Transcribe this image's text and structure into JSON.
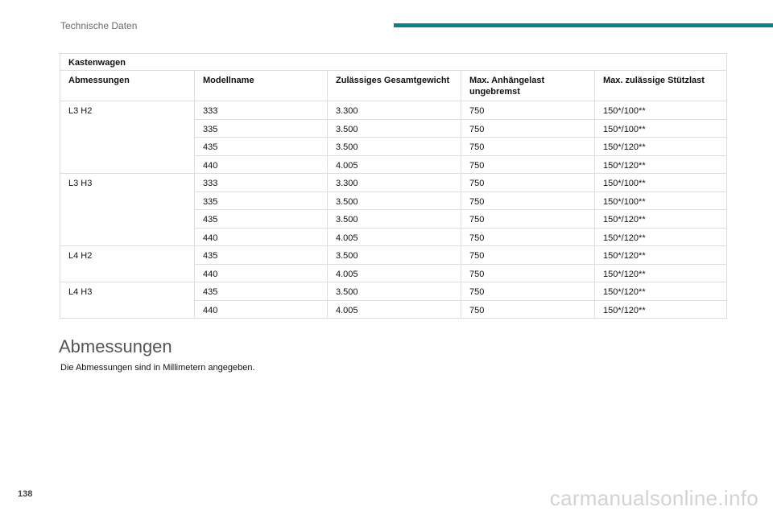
{
  "header": {
    "section_title": "Technische Daten",
    "accent_color": "#0c7f93"
  },
  "table": {
    "title": "Kastenwagen",
    "columns": [
      "Abmessungen",
      "Modellname",
      "Zulässiges Gesamtgewicht",
      "Max. Anhängelast ungebremst",
      "Max. zulässige Stützlast"
    ],
    "groups": [
      {
        "dimension": "L3 H2",
        "rows": [
          [
            "333",
            "3.300",
            "750",
            "150*/100**"
          ],
          [
            "335",
            "3.500",
            "750",
            "150*/100**"
          ],
          [
            "435",
            "3.500",
            "750",
            "150*/120**"
          ],
          [
            "440",
            "4.005",
            "750",
            "150*/120**"
          ]
        ]
      },
      {
        "dimension": "L3 H3",
        "rows": [
          [
            "333",
            "3.300",
            "750",
            "150*/100**"
          ],
          [
            "335",
            "3.500",
            "750",
            "150*/100**"
          ],
          [
            "435",
            "3.500",
            "750",
            "150*/120**"
          ],
          [
            "440",
            "4.005",
            "750",
            "150*/120**"
          ]
        ]
      },
      {
        "dimension": "L4 H2",
        "rows": [
          [
            "435",
            "3.500",
            "750",
            "150*/120**"
          ],
          [
            "440",
            "4.005",
            "750",
            "150*/120**"
          ]
        ]
      },
      {
        "dimension": "L4 H3",
        "rows": [
          [
            "435",
            "3.500",
            "750",
            "150*/120**"
          ],
          [
            "440",
            "4.005",
            "750",
            "150*/120**"
          ]
        ]
      }
    ]
  },
  "section": {
    "heading": "Abmessungen",
    "text": "Die Abmessungen sind in Millimetern angegeben."
  },
  "footer": {
    "page_number": "138",
    "watermark": "carmanualsonline.info"
  }
}
